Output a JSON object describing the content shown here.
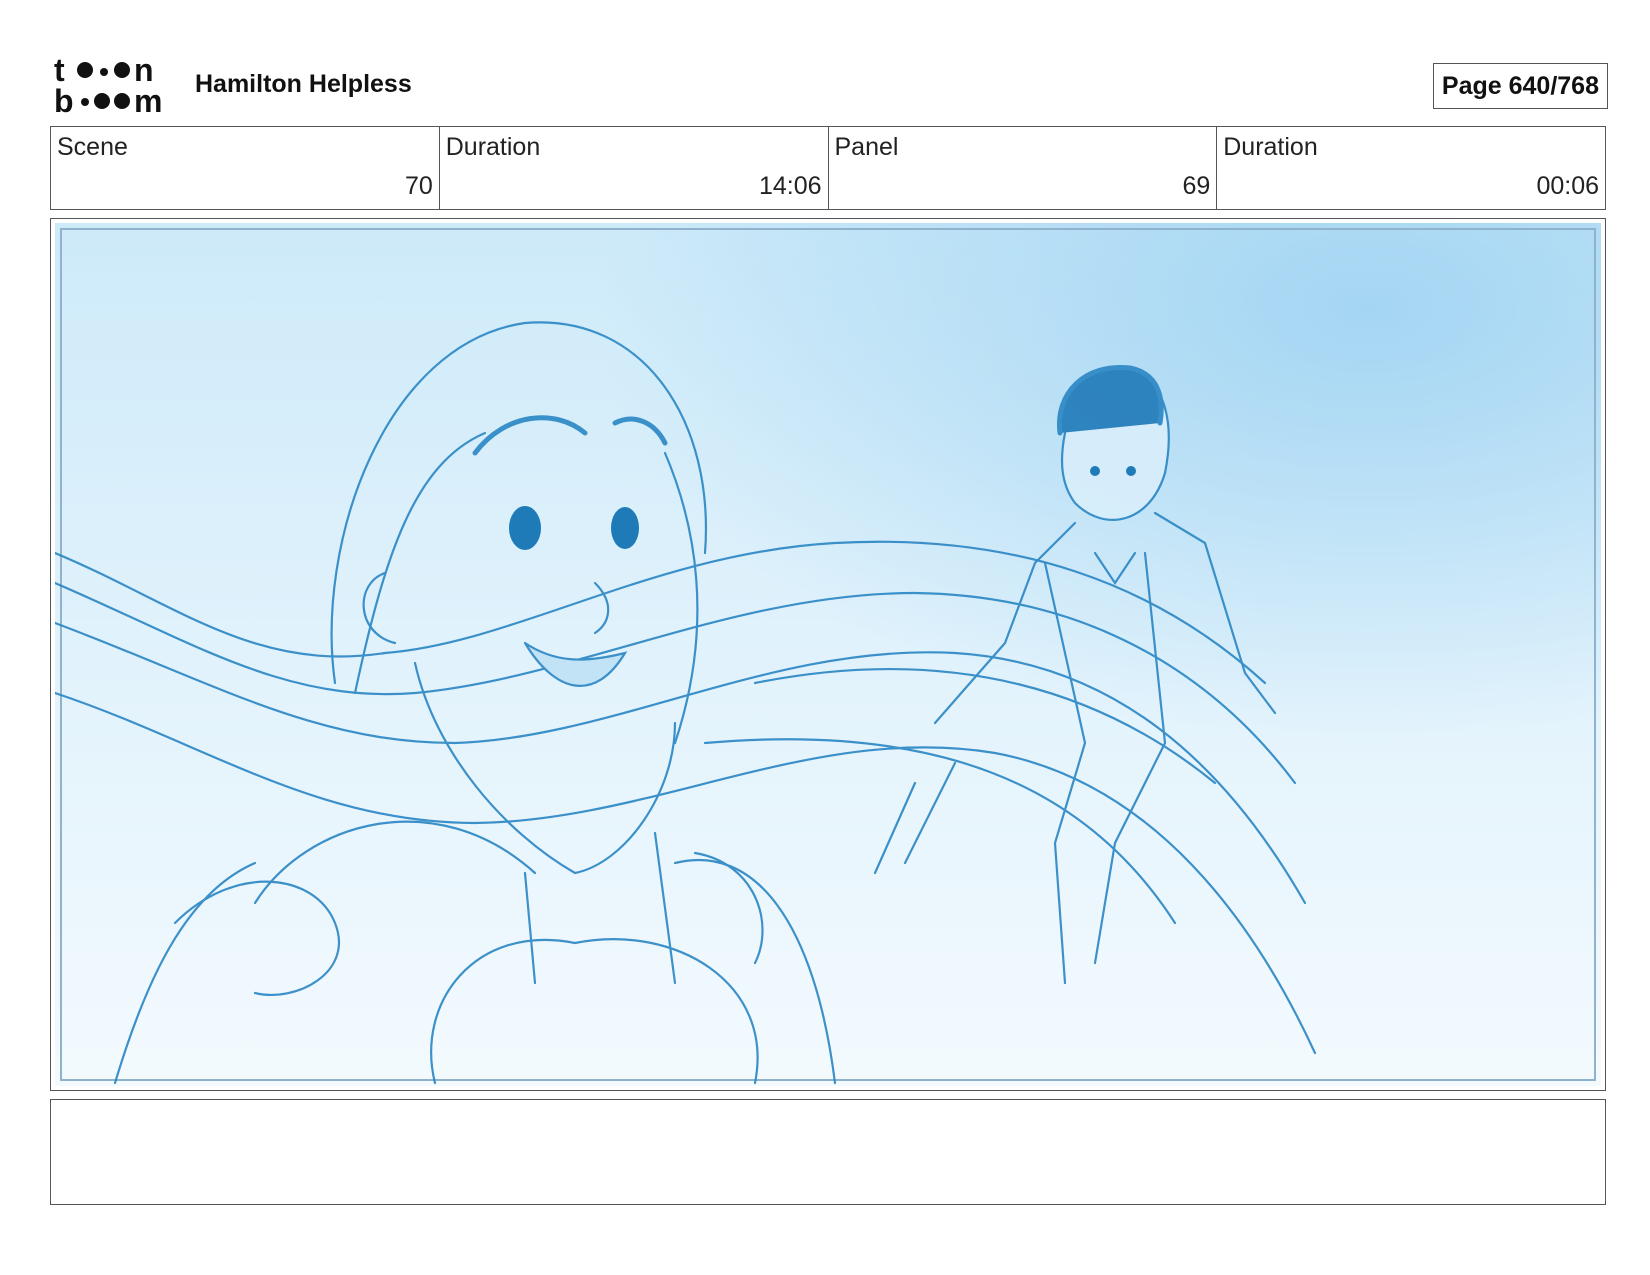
{
  "header": {
    "project_title": "Hamilton Helpless",
    "page_label": "Page 640/768"
  },
  "logo": {
    "name": "toonboom-logo",
    "text": "toon boom"
  },
  "info": {
    "scene_label": "Scene",
    "scene_value": "70",
    "scene_duration_label": "Duration",
    "scene_duration_value": "14:06",
    "panel_label": "Panel",
    "panel_value": "69",
    "panel_duration_label": "Duration",
    "panel_duration_value": "00:06"
  },
  "panel": {
    "image_icon": "storyboard-sketch",
    "colors": {
      "sky_light": "#eaf6fd",
      "sky_mid": "#bfe3f7",
      "line": "#2a86c4"
    }
  },
  "notes": {
    "text": ""
  }
}
